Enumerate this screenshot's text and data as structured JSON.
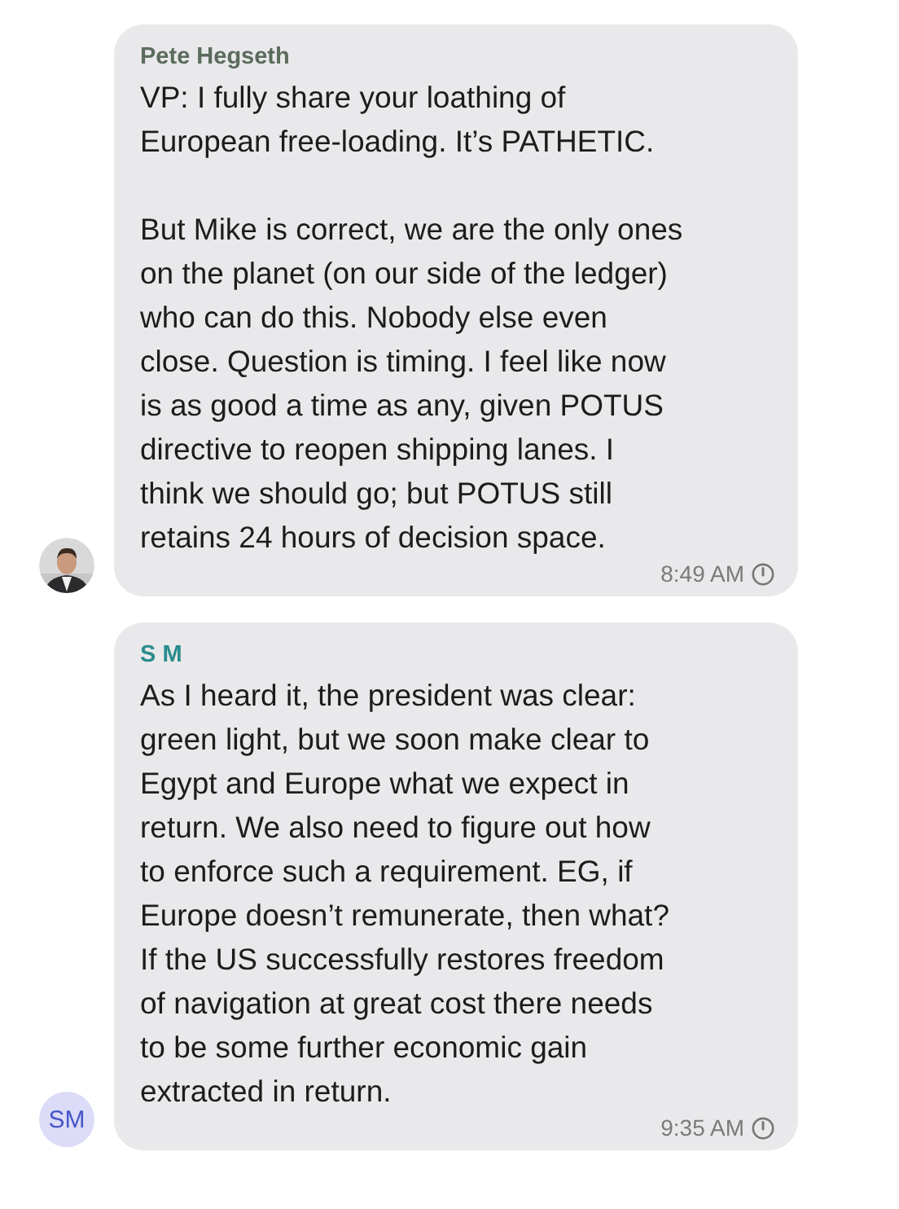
{
  "messages": [
    {
      "sender": "Pete Hegseth",
      "color": "#5b6b5c",
      "paragraphs": [
        [
          "VP: I fully share your loathing of",
          "European free-loading. It’s PATHETIC."
        ],
        [
          "But Mike is correct, we are the only ones",
          "on the planet (on our side of the ledger)",
          "who can do this. Nobody else even",
          "close. Question is timing. I feel like now",
          "is as good a time as any, given POTUS",
          "directive to reopen shipping lanes. I",
          "think we should go; but POTUS still",
          "retains 24 hours of decision space."
        ]
      ],
      "time": "8:49 AM"
    },
    {
      "sender": "S M",
      "color": "#2b8c8c",
      "avatar": {
        "kind": "initials",
        "text": "SM"
      },
      "paragraphs": [
        [
          "As I heard it, the president was clear:",
          "green light, but we soon make clear to",
          "Egypt and Europe what we expect in",
          "return. We also need to figure out how",
          "to enforce such a requirement. EG, if",
          "Europe doesn’t remunerate, then what?",
          "If the US successfully restores freedom",
          "of navigation at great cost there needs",
          "to be some further economic gain",
          "extracted in return."
        ]
      ],
      "time": "9:35 AM"
    }
  ]
}
